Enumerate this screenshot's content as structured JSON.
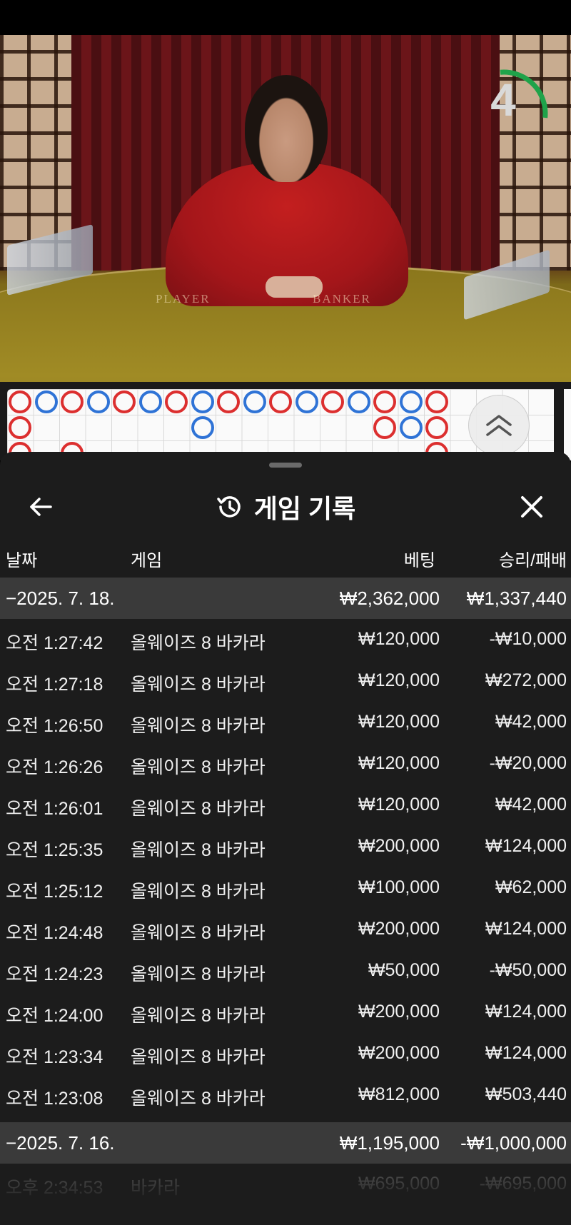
{
  "video": {
    "countdown": "4",
    "countdown_fraction": 0.28,
    "felt_player": "PLAYER",
    "felt_banker": "BANKER"
  },
  "roadmap": {
    "row1": [
      "red",
      "blue",
      "red",
      "blue",
      "red",
      "blue",
      "red",
      "blue",
      "red",
      "blue",
      "red",
      "blue",
      "red",
      "blue",
      "red",
      "blue",
      "red"
    ],
    "row2": {
      "0": "red",
      "7": "blue",
      "14": "red",
      "15": "blue",
      "16": "red"
    },
    "colors": {
      "red": "#dc2f2f",
      "blue": "#2f73d6"
    }
  },
  "panel": {
    "title": "게임 기록",
    "title_icon": "history-icon",
    "back_icon": "arrow-left-icon",
    "close_icon": "close-icon"
  },
  "columns": {
    "date": "날짜",
    "game": "게임",
    "bet": "베팅",
    "win_loss": "승리/패배"
  },
  "groups": [
    {
      "date": "−2025. 7. 18.",
      "bet_total": "₩2,362,000",
      "win_total": "₩1,337,440",
      "rows": [
        {
          "time": "오전 1:27:42",
          "game": "올웨이즈 8 바카라",
          "bet": "₩120,000",
          "win": "-₩10,000"
        },
        {
          "time": "오전 1:27:18",
          "game": "올웨이즈 8 바카라",
          "bet": "₩120,000",
          "win": "₩272,000"
        },
        {
          "time": "오전 1:26:50",
          "game": "올웨이즈 8 바카라",
          "bet": "₩120,000",
          "win": "₩42,000"
        },
        {
          "time": "오전 1:26:26",
          "game": "올웨이즈 8 바카라",
          "bet": "₩120,000",
          "win": "-₩20,000"
        },
        {
          "time": "오전 1:26:01",
          "game": "올웨이즈 8 바카라",
          "bet": "₩120,000",
          "win": "₩42,000"
        },
        {
          "time": "오전 1:25:35",
          "game": "올웨이즈 8 바카라",
          "bet": "₩200,000",
          "win": "₩124,000"
        },
        {
          "time": "오전 1:25:12",
          "game": "올웨이즈 8 바카라",
          "bet": "₩100,000",
          "win": "₩62,000"
        },
        {
          "time": "오전 1:24:48",
          "game": "올웨이즈 8 바카라",
          "bet": "₩200,000",
          "win": "₩124,000"
        },
        {
          "time": "오전 1:24:23",
          "game": "올웨이즈 8 바카라",
          "bet": "₩50,000",
          "win": "-₩50,000"
        },
        {
          "time": "오전 1:24:00",
          "game": "올웨이즈 8 바카라",
          "bet": "₩200,000",
          "win": "₩124,000"
        },
        {
          "time": "오전 1:23:34",
          "game": "올웨이즈 8 바카라",
          "bet": "₩200,000",
          "win": "₩124,000"
        },
        {
          "time": "오전 1:23:08",
          "game": "올웨이즈 8 바카라",
          "bet": "₩812,000",
          "win": "₩503,440"
        }
      ]
    },
    {
      "date": "−2025. 7. 16.",
      "bet_total": "₩1,195,000",
      "win_total": "-₩1,000,000",
      "rows": [
        {
          "time": "오후 2:34:53",
          "game": "바카라",
          "bet": "₩695,000",
          "win": "-₩695,000"
        }
      ]
    }
  ]
}
